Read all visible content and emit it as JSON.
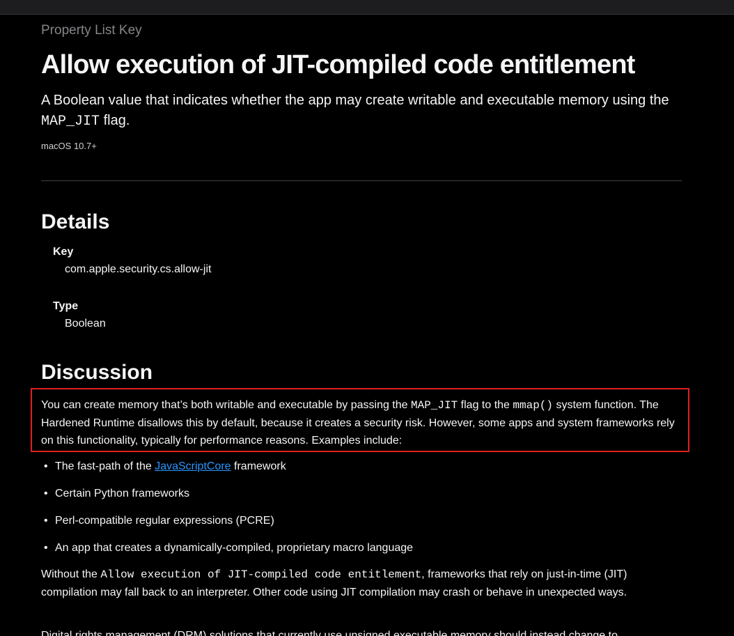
{
  "header": {
    "eyebrow": "Property List Key",
    "title": "Allow execution of JIT-compiled code entitlement",
    "abstract_before": "A Boolean value that indicates whether the app may create writable and executable memory using the ",
    "abstract_code": "MAP_JIT",
    "abstract_after": " flag.",
    "availability": "macOS 10.7+"
  },
  "details": {
    "heading": "Details",
    "key_label": "Key",
    "key_value": "com.apple.security.cs.allow-jit",
    "type_label": "Type",
    "type_value": "Boolean"
  },
  "discussion": {
    "heading": "Discussion",
    "para1": {
      "t1": "You can create memory that’s both writable and executable by passing the ",
      "c1": "MAP_JIT",
      "t2": " flag to the ",
      "c2": "mmap()",
      "t3": " system function. The Hardened Runtime disallows this by default, because it creates a security risk. However, some apps and system frameworks rely on this functionality, typically for performance reasons. Examples include:"
    },
    "bullet_glyph": "•",
    "bullets": {
      "b1_before": "The fast-path of the ",
      "b1_link": "JavaScriptCore",
      "b1_after": " framework",
      "b2": "Certain Python frameworks",
      "b3": "Perl-compatible regular expressions (PCRE)",
      "b4": "An app that creates a dynamically-compiled, proprietary macro language"
    },
    "para2": {
      "t1": "Without the ",
      "c1": "Allow execution of JIT-compiled code entitlement",
      "t2": ", frameworks that rely on just-in-time (JIT) compilation may fall back to an interpreter. Other code using JIT compilation may crash or behave in unexpected ways."
    },
    "para3": "Digital rights management (DRM) solutions that currently use unsigned executable memory should instead change to"
  },
  "colors": {
    "background": "#000000",
    "text": "#f5f5f7",
    "secondary_text": "#86868b",
    "link": "#2997ff",
    "highlight": "#e0201f"
  }
}
